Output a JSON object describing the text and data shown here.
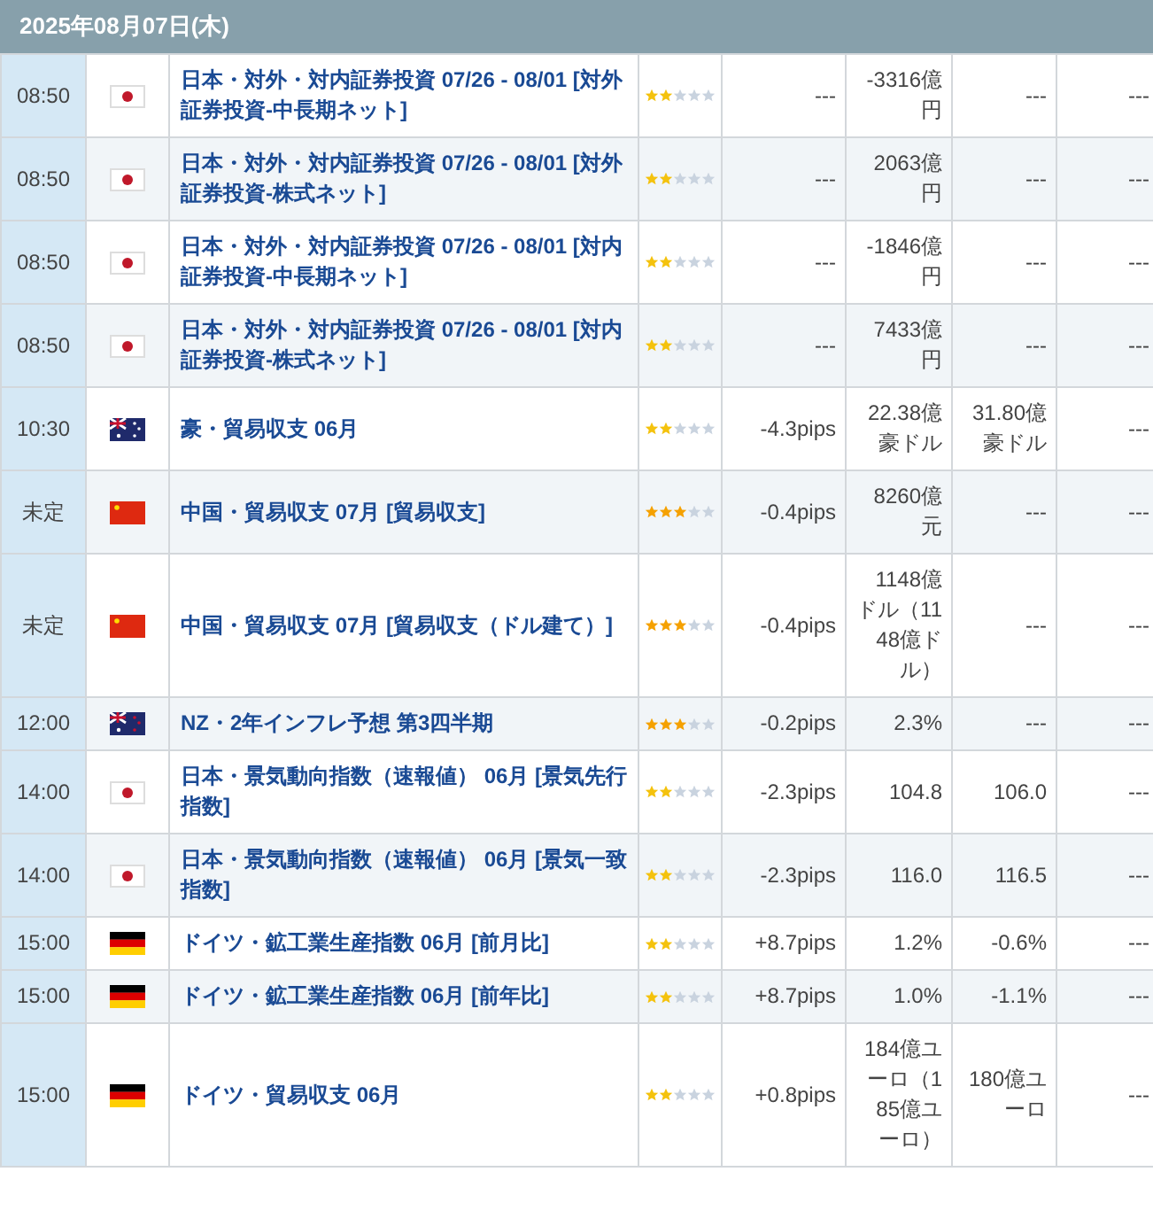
{
  "date_header": "2025年08月07日(木)",
  "rows": [
    {
      "time": "08:50",
      "flag": {
        "kind": "jp"
      },
      "title": "日本・対外・対内証券投資 07/26 - 08/01 [対外証券投資-中長期ネット]",
      "stars": 2,
      "column_5": "---",
      "column_6": "-3316億円",
      "column_7": "---",
      "column_8": "---"
    },
    {
      "time": "08:50",
      "flag": {
        "kind": "jp"
      },
      "title": "日本・対外・対内証券投資 07/26 - 08/01 [対外証券投資-株式ネット]",
      "stars": 2,
      "column_5": "---",
      "column_6": "2063億円",
      "column_7": "---",
      "column_8": "---"
    },
    {
      "time": "08:50",
      "flag": {
        "kind": "jp"
      },
      "title": "日本・対外・対内証券投資 07/26 - 08/01 [対内証券投資-中長期ネット]",
      "stars": 2,
      "column_5": "---",
      "column_6": "-1846億円",
      "column_7": "---",
      "column_8": "---"
    },
    {
      "time": "08:50",
      "flag": {
        "kind": "jp"
      },
      "title": "日本・対外・対内証券投資 07/26 - 08/01 [対内証券投資-株式ネット]",
      "stars": 2,
      "column_5": "---",
      "column_6": "7433億円",
      "column_7": "---",
      "column_8": "---"
    },
    {
      "time": "10:30",
      "flag": {
        "kind": "au"
      },
      "title": "豪・貿易収支 06月",
      "stars": 2,
      "column_5": "-4.3pips",
      "column_6": "22.38億豪ドル",
      "column_7": "31.80億豪ドル",
      "column_8": "---"
    },
    {
      "time": "未定",
      "flag": {
        "kind": "cn"
      },
      "title": "中国・貿易収支 07月 [貿易収支]",
      "stars": 3,
      "column_5": "-0.4pips",
      "column_6": "8260億元",
      "column_7": "---",
      "column_8": "---"
    },
    {
      "time": "未定",
      "flag": {
        "kind": "cn"
      },
      "title": "中国・貿易収支 07月 [貿易収支（ドル建て）]",
      "stars": 3,
      "column_5": "-0.4pips",
      "column_6": "1148億ドル（1148億ドル）",
      "column_7": "---",
      "column_8": "---"
    },
    {
      "time": "12:00",
      "flag": {
        "kind": "nz"
      },
      "title": "NZ・2年インフレ予想 第3四半期",
      "stars": 3,
      "column_5": "-0.2pips",
      "column_6": "2.3%",
      "column_7": "---",
      "column_8": "---"
    },
    {
      "time": "14:00",
      "flag": {
        "kind": "jp"
      },
      "title": "日本・景気動向指数（速報値） 06月 [景気先行指数]",
      "stars": 2,
      "column_5": "-2.3pips",
      "column_6": "104.8",
      "column_7": "106.0",
      "column_8": "---"
    },
    {
      "time": "14:00",
      "flag": {
        "kind": "jp"
      },
      "title": "日本・景気動向指数（速報値） 06月 [景気一致指数]",
      "stars": 2,
      "column_5": "-2.3pips",
      "column_6": "116.0",
      "column_7": "116.5",
      "column_8": "---"
    },
    {
      "time": "15:00",
      "flag": {
        "kind": "de"
      },
      "title": "ドイツ・鉱工業生産指数 06月 [前月比]",
      "stars": 2,
      "column_5": "+8.7pips",
      "column_6": "1.2%",
      "column_7": "-0.6%",
      "column_8": "---"
    },
    {
      "time": "15:00",
      "flag": {
        "kind": "de"
      },
      "title": "ドイツ・鉱工業生産指数 06月 [前年比]",
      "stars": 2,
      "column_5": "+8.7pips",
      "column_6": "1.0%",
      "column_7": "-1.1%",
      "column_8": "---"
    },
    {
      "time": "15:00",
      "flag": {
        "kind": "de"
      },
      "title": "ドイツ・貿易収支 06月",
      "stars": 2,
      "column_5": "+0.8pips",
      "column_6": "184億ユーロ（185億ユーロ）",
      "column_7": "180億ユーロ",
      "column_8": "---"
    }
  ]
}
